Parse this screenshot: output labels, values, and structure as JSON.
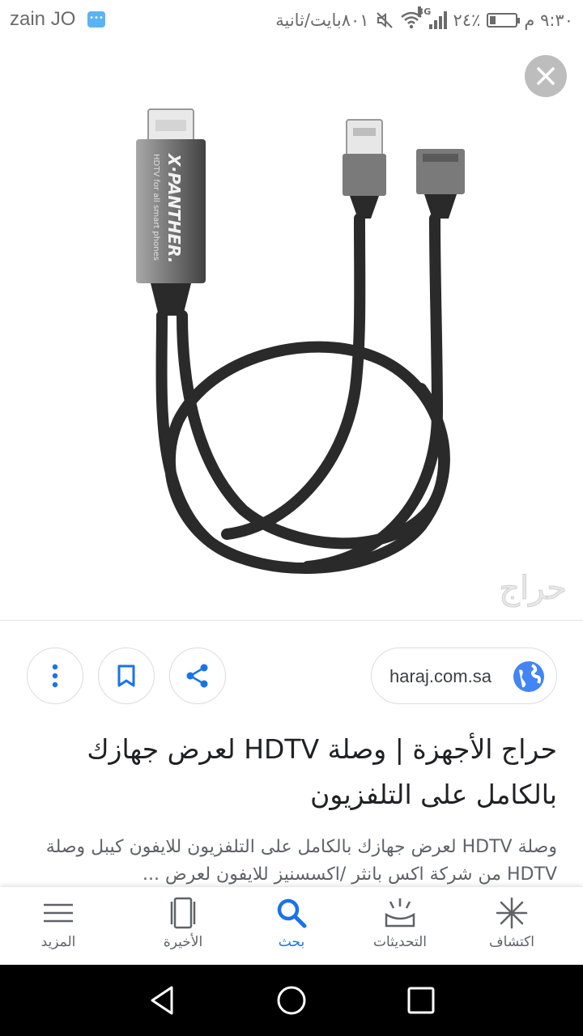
{
  "status_bar": {
    "carrier": "zain JO",
    "time": "٩:٣٠ م",
    "battery": "٢٤٪",
    "battery_level": 0.24,
    "network": "3G",
    "data_speed": "٨٠١بايت/ثانية"
  },
  "image_viewer": {
    "product_text": "X·PANTHER.",
    "product_subtext": "HDTV for all smart phones",
    "watermark": "حراج"
  },
  "actions": {
    "source": "haraj.com.sa"
  },
  "result": {
    "title": "حراج الأجهزة | وصلة HDTV لعرض جهازك بالكامل على التلفزيون",
    "description": "وصلة HDTV لعرض جهازك بالكامل على التلفزيون للايفون كيبل وصلة HDTV من شركة اكس بانثر /اكسسنيز للايفون لعرض ..."
  },
  "bottom_nav": {
    "items": [
      {
        "label": "اكتشاف",
        "icon": "discover-icon"
      },
      {
        "label": "التحديثات",
        "icon": "updates-icon"
      },
      {
        "label": "بحث",
        "icon": "search-icon"
      },
      {
        "label": "الأخيرة",
        "icon": "recent-icon"
      },
      {
        "label": "المزيد",
        "icon": "menu-icon"
      }
    ],
    "active_color": "#1a73e8"
  },
  "colors": {
    "google_blue": "#1a73e8",
    "globe_blue": "#4285f4"
  }
}
